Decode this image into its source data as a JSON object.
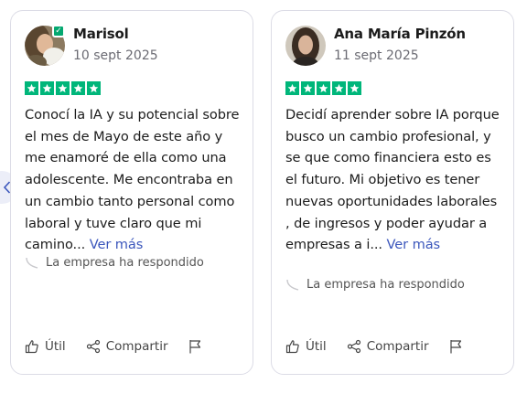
{
  "reviews": [
    {
      "name": "Marisol",
      "date": "10 sept 2025",
      "verified": true,
      "rating": 5,
      "text": "Conocí la IA y su potencial sobre el mes de Mayo de este año y me enamoré de ella como una adolescente. Me encontraba en un cambio tanto personal como laboral y tuve claro que mi camino...",
      "more": "Ver más",
      "reply": "La empresa ha respondido"
    },
    {
      "name": "Ana María Pinzón",
      "date": "11 sept 2025",
      "verified": false,
      "rating": 5,
      "text": "Decidí aprender sobre IA porque busco un cambio profesional, y se que como financiera esto es el futuro. Mi objetivo es tener nuevas oportunidades laborales , de ingresos y poder ayudar a empresas a i...",
      "more": "Ver más",
      "reply": "La empresa ha respondido"
    }
  ],
  "actions": {
    "useful": "Útil",
    "share": "Compartir"
  },
  "icons": [
    "chevron-left-icon",
    "verified-check-icon",
    "star-icon",
    "reply-arrow-icon",
    "thumbs-up-icon",
    "share-icon",
    "flag-icon"
  ],
  "colors": {
    "star_green": "#00b67a",
    "link_blue": "#3c57bc",
    "verified_green": "#04a870"
  }
}
